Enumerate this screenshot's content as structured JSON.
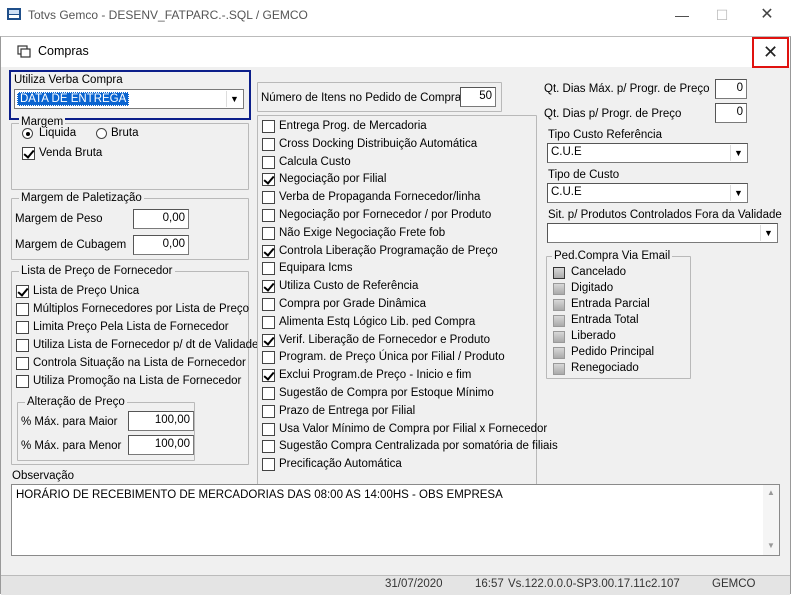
{
  "app": {
    "title": "Totvs Gemco - DESENV_FATPARC.-.SQL / GEMCO"
  },
  "dialog": {
    "title": "Compras"
  },
  "verba": {
    "label": "Utiliza Verba Compra",
    "value": "DATA DE ENTREGA"
  },
  "margem": {
    "legend": "Margem",
    "radio_liquida": "Liquida",
    "radio_liquida_selected": true,
    "radio_bruta": "Bruta",
    "venda_bruta": "Venda Bruta",
    "venda_bruta_checked": true
  },
  "paletizacao": {
    "legend": "Margem de Paletização",
    "peso_label": "Margem de Peso",
    "peso_value": "0,00",
    "cubagem_label": "Margem de Cubagem",
    "cubagem_value": "0,00"
  },
  "lista_preco": {
    "legend": "Lista de Preço de Fornecedor",
    "items": [
      {
        "label": "Lista de Preço Unica",
        "checked": true
      },
      {
        "label": "Múltiplos Fornecedores por Lista de Preço",
        "checked": false
      },
      {
        "label": "Limita Preço Pela Lista de Fornecedor",
        "checked": false
      },
      {
        "label": "Utiliza Lista de Fornecedor p/ dt de Validade",
        "checked": false
      },
      {
        "label": "Controla Situação na Lista de Fornecedor",
        "checked": false
      },
      {
        "label": "Utiliza Promoção na Lista de Fornecedor",
        "checked": false
      }
    ]
  },
  "alteracao": {
    "legend": "Alteração de Preço",
    "maior_label": "% Máx. para Maior",
    "maior_value": "100,00",
    "menor_label": "% Máx. para Menor",
    "menor_value": "100,00"
  },
  "itens_pedido": {
    "label": "Número de Itens no Pedido de Compra",
    "value": "50"
  },
  "options": [
    {
      "label": "Entrega Prog. de Mercadoria",
      "checked": false
    },
    {
      "label": "Cross Docking Distribuição Automática",
      "checked": false
    },
    {
      "label": "Calcula Custo",
      "checked": false
    },
    {
      "label": "Negociação por Filial",
      "checked": true
    },
    {
      "label": "Verba de Propaganda Fornecedor/linha",
      "checked": false
    },
    {
      "label": "Negociação por Fornecedor / por Produto",
      "checked": false
    },
    {
      "label": "Não Exige Negociação Frete fob",
      "checked": false
    },
    {
      "label": "Controla Liberação Programação de Preço",
      "checked": true
    },
    {
      "label": "Equipara Icms",
      "checked": false
    },
    {
      "label": "Utiliza Custo de Referência",
      "checked": true
    },
    {
      "label": "Compra por Grade Dinâmica",
      "checked": false
    },
    {
      "label": "Alimenta Estq Lógico Lib. ped Compra",
      "checked": false
    },
    {
      "label": "Verif. Liberação de Fornecedor e Produto",
      "checked": true
    },
    {
      "label": "Program. de Preço Única por Filial / Produto",
      "checked": false
    },
    {
      "label": "Exclui Program.de Preço - Inicio e fim",
      "checked": true
    },
    {
      "label": "Sugestão de Compra por Estoque Mínimo",
      "checked": false
    },
    {
      "label": "Prazo de Entrega por Filial",
      "checked": false
    },
    {
      "label": "Usa Valor Mínimo de Compra por Filial x Fornecedor",
      "checked": false
    },
    {
      "label": "Sugestão Compra Centralizada por somatória de filiais",
      "checked": false
    },
    {
      "label": "Precificação Automática",
      "checked": false
    }
  ],
  "right": {
    "dias_max_label": "Qt. Dias Máx. p/ Progr. de Preço",
    "dias_max_value": "0",
    "dias_label": "Qt. Dias p/ Progr. de Preço",
    "dias_value": "0",
    "tipo_ref_label": "Tipo Custo Referência",
    "tipo_ref_value": "C.U.E",
    "tipo_custo_label": "Tipo de Custo",
    "tipo_custo_value": "C.U.E",
    "sit_label": "Sit. p/ Produtos Controlados Fora da Validade",
    "sit_value": ""
  },
  "email": {
    "legend": "Ped.Compra Via Email",
    "statuses": [
      "Cancelado",
      "Digitado",
      "Entrada Parcial",
      "Entrada Total",
      "Liberado",
      "Pedido Principal",
      "Renegociado"
    ]
  },
  "observacao": {
    "label": "Observação",
    "text": "HORÁRIO DE RECEBIMENTO DE MERCADORIAS DAS 08:00 AS 14:00HS - OBS EMPRESA"
  },
  "bottom_strip": {
    "date": "31/07/2020",
    "time": "16:57",
    "version": "Vs.122.0.0.0-SP3.00.17.11c2.107",
    "app": "GEMCO"
  },
  "colors": {
    "focus_border": "#0b1e8a",
    "close_border": "#e0120f",
    "selection": "#0a64d0",
    "dialog_bg": "#f0f0f0"
  }
}
